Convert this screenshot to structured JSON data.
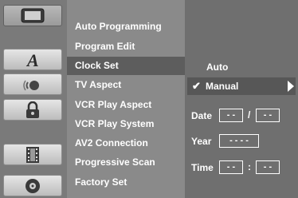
{
  "icons": [
    {
      "name": "tv-icon",
      "selected": true
    },
    {
      "name": "language-icon",
      "glyph": "A"
    },
    {
      "name": "audio-icon"
    },
    {
      "name": "lock-icon"
    },
    {
      "name": "film-icon"
    },
    {
      "name": "disc-icon"
    }
  ],
  "menu": {
    "items": [
      {
        "label": "Auto Programming"
      },
      {
        "label": "Program Edit"
      },
      {
        "label": "Clock Set"
      },
      {
        "label": "TV Aspect"
      },
      {
        "label": "VCR Play Aspect"
      },
      {
        "label": "VCR Play System"
      },
      {
        "label": "AV2 Connection"
      },
      {
        "label": "Progressive Scan"
      },
      {
        "label": "Factory Set"
      }
    ],
    "active_index": 2
  },
  "panel": {
    "auto_label": "Auto",
    "manual_label": "Manual",
    "check_glyph": "✔",
    "date_label": "Date",
    "date_month": "- -",
    "date_sep": "/",
    "date_day": "- -",
    "year_label": "Year",
    "year_value": "- - - -",
    "time_label": "Time",
    "time_hour": "- -",
    "time_sep": ":",
    "time_min": "- -"
  }
}
